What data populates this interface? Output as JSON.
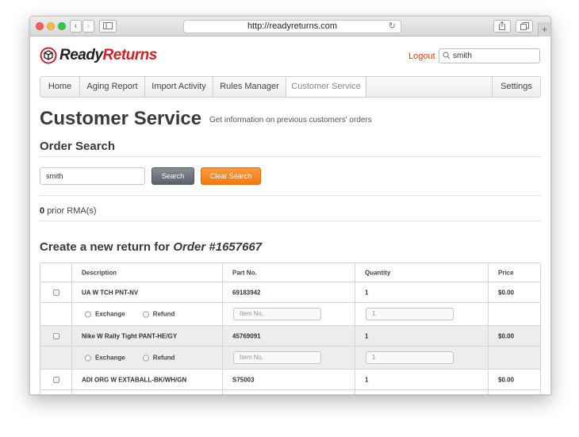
{
  "browser": {
    "url": "http://readyreturns.com"
  },
  "header": {
    "logo_part1": "Ready",
    "logo_part2": "Returns",
    "logout": "Logout",
    "search_value": "smith"
  },
  "nav": {
    "items": [
      "Home",
      "Aging Report",
      "Import Activity",
      "Rules Manager",
      "Customer Service"
    ],
    "settings": "Settings",
    "active": "Customer Service"
  },
  "page": {
    "title": "Customer Service",
    "subtitle": "Get information on previous customers' orders"
  },
  "order_search": {
    "title": "Order Search",
    "input_value": "smith",
    "search_button": "Search",
    "clear_button": "Clear Search"
  },
  "prior": {
    "count": "0",
    "label": "prior RMA(s)"
  },
  "create_return": {
    "prefix": "Create a new return for",
    "order": "Order #1657667"
  },
  "table": {
    "headers": [
      "Description",
      "Part No.",
      "Quantity",
      "Price"
    ],
    "exchange_label": "Exchange",
    "refund_label": "Refund",
    "item_placeholder": "Item No.",
    "qty_placeholder": "1",
    "rows": [
      {
        "description": "UA W TCH PNT-NV",
        "part_no": "69183942",
        "quantity": "1",
        "price": "$0.00"
      },
      {
        "description": "Nike W Rally Tight PANT-HE/GY",
        "part_no": "45769091",
        "quantity": "1",
        "price": "$0.00"
      },
      {
        "description": "ADI ORG W EXTABALL-BK/WH/GN",
        "part_no": "S75003",
        "quantity": "1",
        "price": "$0.00"
      }
    ]
  },
  "colors": {
    "brand_red": "#d0202a",
    "logout": "#d64a1d",
    "clear_button": "#f47a12",
    "search_button": "#5b5f67"
  }
}
